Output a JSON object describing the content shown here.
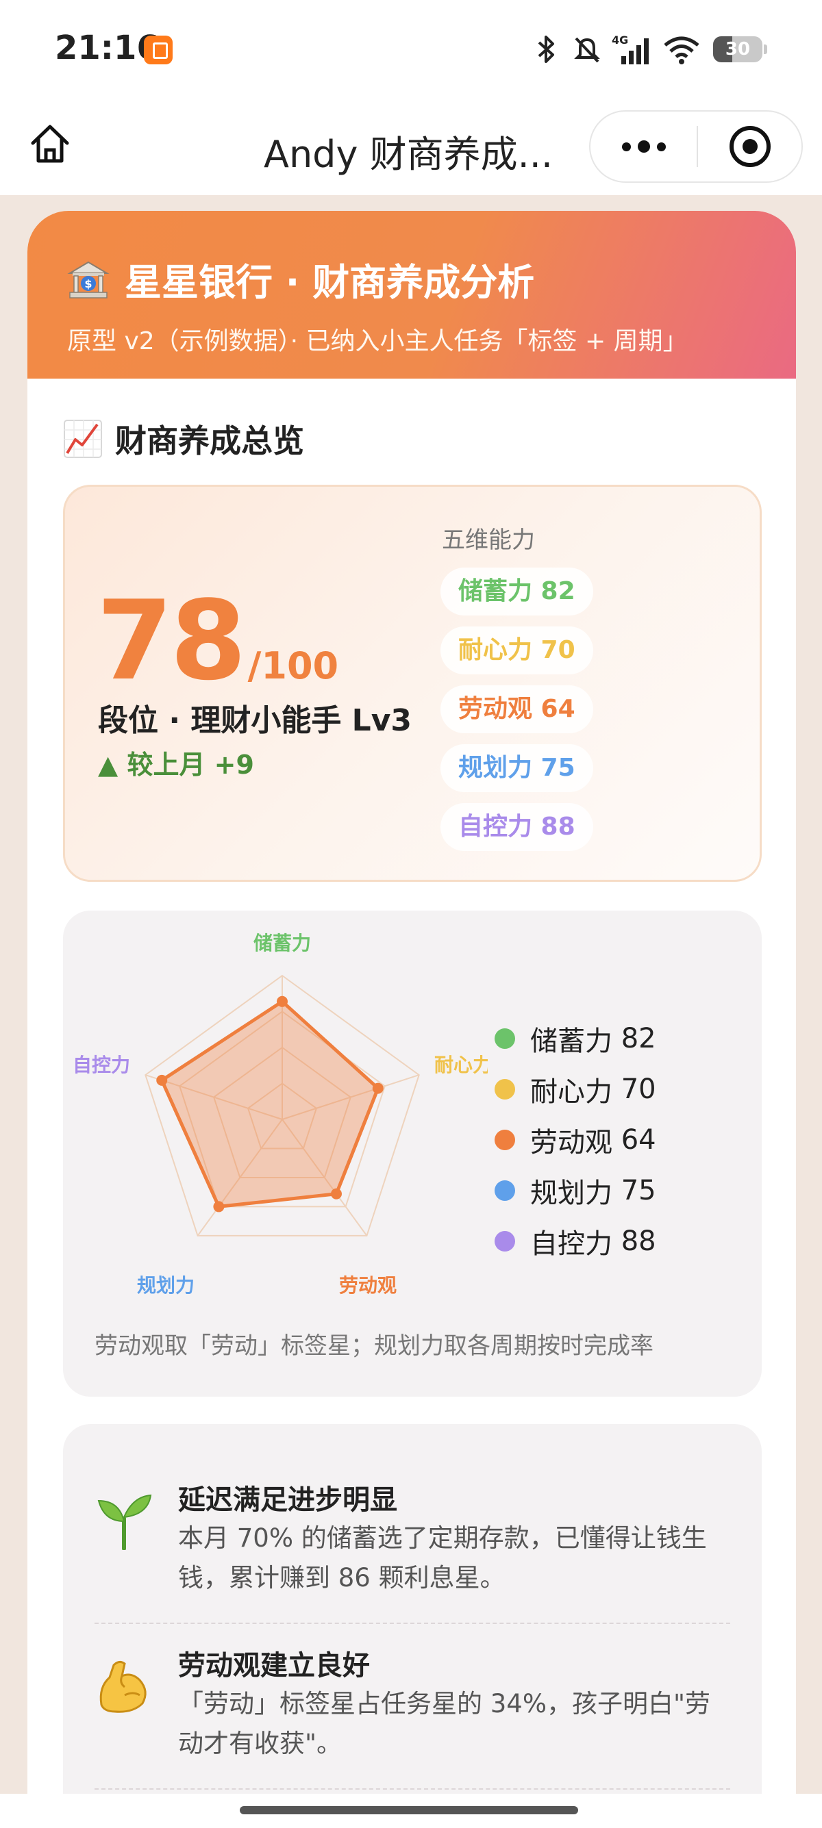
{
  "status_bar": {
    "time": "21:16",
    "signal_label": "4G",
    "battery": "30",
    "icons": [
      "app-notification-icon",
      "bluetooth-icon",
      "mute-icon",
      "cellular-signal-icon",
      "wifi-icon",
      "battery-icon"
    ]
  },
  "nav": {
    "title": "Andy 财商养成...",
    "icons": [
      "home-icon",
      "more-icon",
      "close-miniprogram-icon"
    ]
  },
  "hero": {
    "title": "星星银行 · 财商养成分析",
    "subtitle": "原型 v2（示例数据）· 已纳入小主人任务「标签 + 周期」",
    "icon": "bank-icon"
  },
  "overview": {
    "section_title": "财商养成总览",
    "icon": "chart-increasing-icon",
    "score": "78",
    "score_max": "/100",
    "rank": "段位 · 理财小能手 Lv3",
    "trend": "▲ 较上月 +9",
    "abilities_label": "五维能力",
    "abilities": [
      {
        "label": "储蓄力 82",
        "color": "#6cc36a"
      },
      {
        "label": "耐心力 70",
        "color": "#f0c24a"
      },
      {
        "label": "劳动观 64",
        "color": "#ef7f3e"
      },
      {
        "label": "规划力 75",
        "color": "#5fa0ea"
      },
      {
        "label": "自控力 88",
        "color": "#a98bea"
      }
    ]
  },
  "radar": {
    "axes": [
      {
        "name": "储蓄力",
        "value": 82,
        "color": "#6cc36a"
      },
      {
        "name": "耐心力",
        "value": 70,
        "color": "#f0c24a"
      },
      {
        "name": "劳动观",
        "value": 64,
        "color": "#ef7f3e"
      },
      {
        "name": "规划力",
        "value": 75,
        "color": "#5fa0ea"
      },
      {
        "name": "自控力",
        "value": 88,
        "color": "#a98bea"
      }
    ],
    "max": 100,
    "fill_color": "#ef7f3e",
    "legend": [
      {
        "name": "储蓄力",
        "value": "82",
        "color": "#6cc36a"
      },
      {
        "name": "耐心力",
        "value": "70",
        "color": "#f0c24a"
      },
      {
        "name": "劳动观",
        "value": "64",
        "color": "#ef7f3e"
      },
      {
        "name": "规划力",
        "value": "75",
        "color": "#5fa0ea"
      },
      {
        "name": "自控力",
        "value": "88",
        "color": "#a98bea"
      }
    ],
    "note": "劳动观取「劳动」标签星；规划力取各周期按时完成率"
  },
  "insights": [
    {
      "icon": "seedling-icon",
      "title": "延迟满足进步明显",
      "text": "本月 70% 的储蓄选了定期存款，已懂得让钱生钱，累计赚到 86 颗利息星。"
    },
    {
      "icon": "flexed-biceps-icon",
      "title": "劳动观建立良好",
      "text": "「劳动」标签星占任务星的 34%，孩子明白\"劳动才有收获\"。"
    }
  ]
}
